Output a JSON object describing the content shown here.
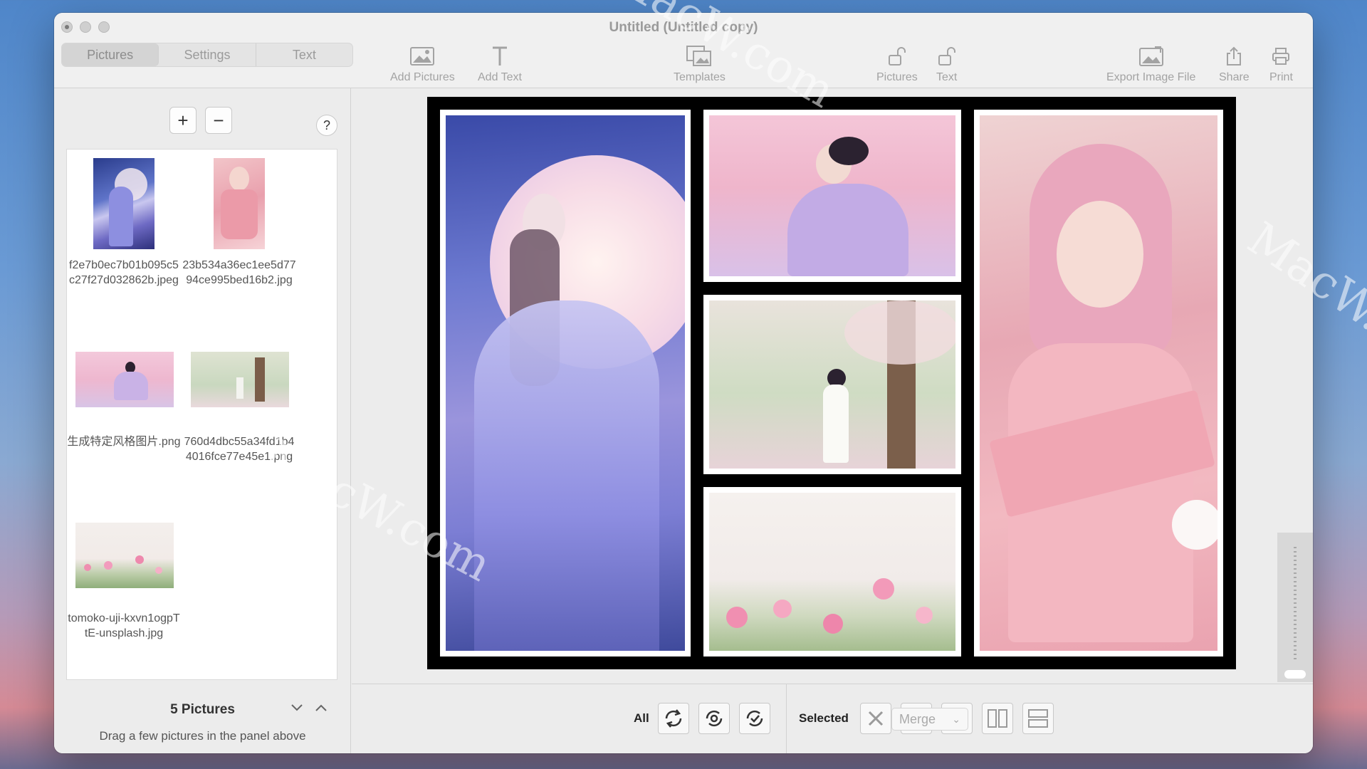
{
  "window": {
    "title": "Untitled (Untitled copy)"
  },
  "tabs": [
    {
      "label": "Pictures",
      "active": true
    },
    {
      "label": "Settings",
      "active": false
    },
    {
      "label": "Text",
      "active": false
    }
  ],
  "toolbar": {
    "add_pictures": "Add Pictures",
    "add_text": "Add Text",
    "templates": "Templates",
    "lock_pictures": "Pictures",
    "lock_text": "Text",
    "export": "Export Image File",
    "share": "Share",
    "print": "Print"
  },
  "sidebar": {
    "add_label": "+",
    "remove_label": "−",
    "help_label": "?",
    "pictures": [
      {
        "name": "f2e7b0ec7b01b095c5c27f27d032862b.jpeg"
      },
      {
        "name": "23b534a36ec1ee5d7794ce995bed16b2.jpg"
      },
      {
        "name": "生成特定风格图片.png"
      },
      {
        "name": "760d4dbc55a34fd1b44016fce77e45e1.png"
      },
      {
        "name": "tomoko-uji-kxvn1ogpTtE-unsplash.jpg"
      }
    ],
    "count_label": "5 Pictures",
    "hint": "Drag a few pictures in the panel above"
  },
  "bottombar": {
    "all_label": "All",
    "selected_label": "Selected",
    "merge_label": "Merge"
  },
  "watermark": "MacW.com",
  "colors": {
    "window_bg": "#ececec",
    "collage_bg": "#000000",
    "frame": "#ffffff"
  }
}
